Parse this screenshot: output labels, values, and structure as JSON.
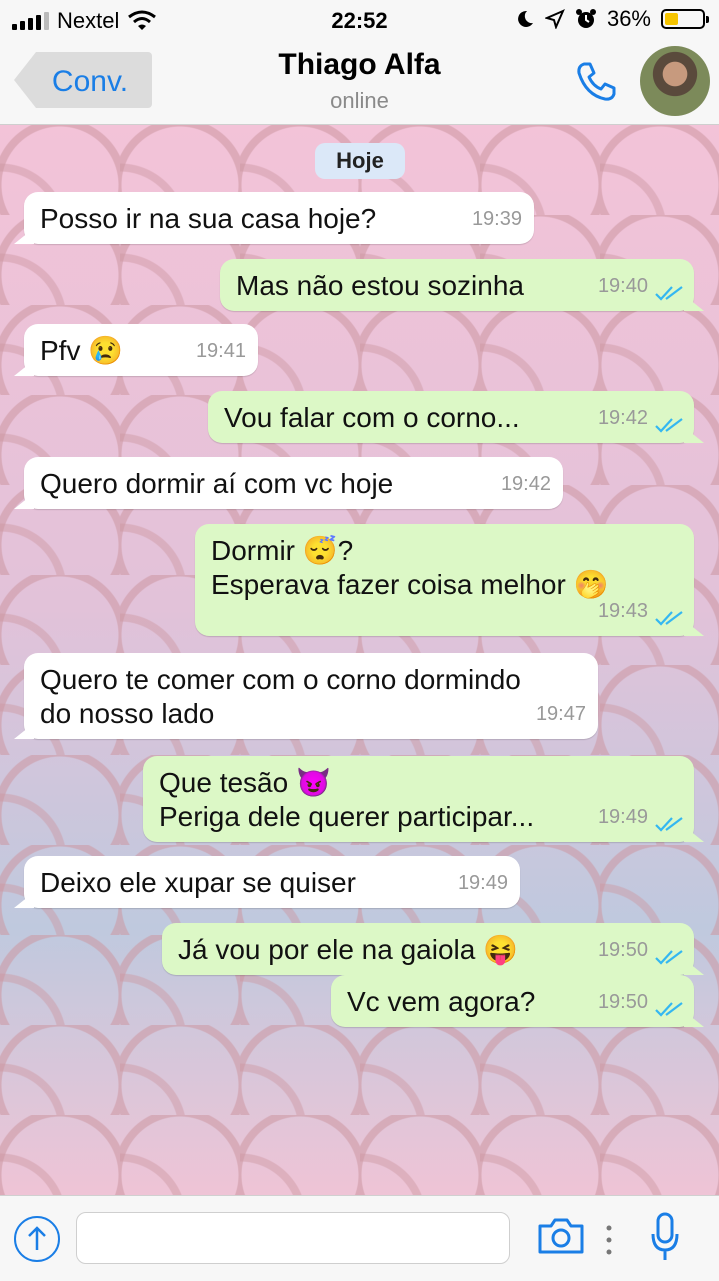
{
  "status_bar": {
    "carrier": "Nextel",
    "time": "22:52",
    "battery_percent": "36%",
    "battery_level": 0.36
  },
  "header": {
    "back_label": "Conv.",
    "contact_name": "Thiago Alfa",
    "status": "online"
  },
  "chat": {
    "day_label": "Hoje",
    "messages": [
      {
        "direction": "in",
        "text": "Posso ir na sua casa hoje?",
        "time": "19:39"
      },
      {
        "direction": "out",
        "text": "Mas não estou sozinha",
        "time": "19:40",
        "read": true
      },
      {
        "direction": "in",
        "text": "Pfv 😢",
        "time": "19:41"
      },
      {
        "direction": "out",
        "text": "Vou falar com o corno...",
        "time": "19:42",
        "read": true
      },
      {
        "direction": "in",
        "text": "Quero dormir aí com vc hoje",
        "time": "19:42"
      },
      {
        "direction": "out",
        "text": "Dormir 😴?\nEsperava fazer coisa melhor 🤭",
        "time": "19:43",
        "read": true
      },
      {
        "direction": "in",
        "text": "Quero te comer com o corno dormindo\ndo nosso lado",
        "time": "19:47"
      },
      {
        "direction": "out",
        "text": "Que tesão 😈\nPeriga dele querer participar...",
        "time": "19:49",
        "read": true
      },
      {
        "direction": "in",
        "text": "Deixo ele xupar se quiser",
        "time": "19:49"
      },
      {
        "direction": "out",
        "text": "Já vou por ele na gaiola 😝",
        "time": "19:50",
        "read": true
      },
      {
        "direction": "out",
        "text": "Vc vem agora?",
        "time": "19:50",
        "read": true
      }
    ]
  },
  "composer": {
    "placeholder": ""
  },
  "colors": {
    "accent": "#1a7ee6",
    "outgoing_bubble": "#dcf8c6",
    "incoming_bubble": "#ffffff",
    "read_ticks": "#34b7f1"
  }
}
